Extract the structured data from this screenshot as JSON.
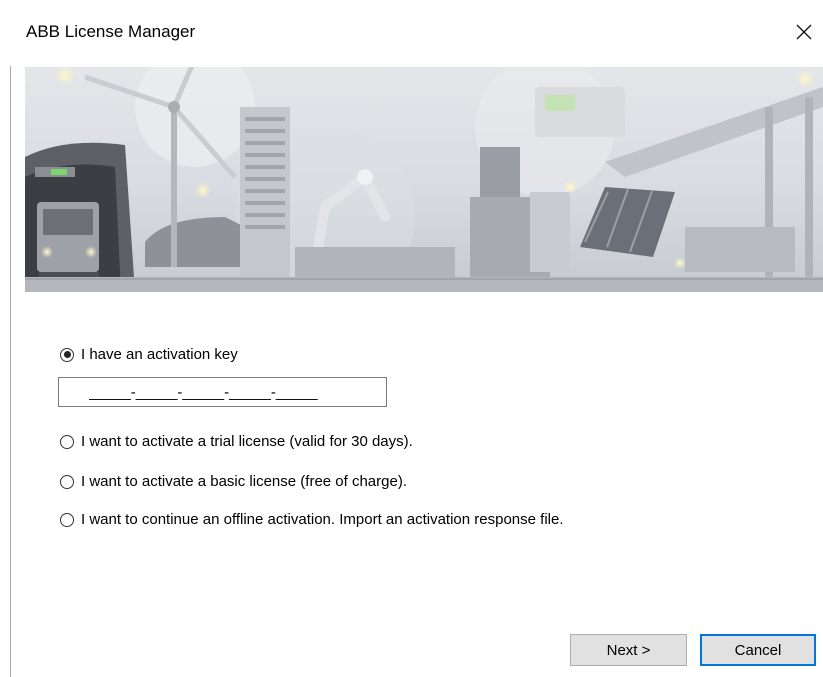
{
  "window": {
    "title": "ABB License Manager"
  },
  "options": {
    "activation_key": {
      "label": "I have an activation key",
      "selected": true
    },
    "key_value": "_____-_____-_____-_____-_____",
    "trial": {
      "label": "I want to activate a trial license (valid for 30 days).",
      "selected": false
    },
    "basic": {
      "label": "I want to activate a basic license (free of charge).",
      "selected": false
    },
    "offline": {
      "label": "I want to continue an offline activation. Import an activation response file.",
      "selected": false
    }
  },
  "buttons": {
    "next": "Next >",
    "cancel": "Cancel"
  },
  "colors": {
    "accent": "#0078d7",
    "button_face": "#e1e1e1"
  }
}
